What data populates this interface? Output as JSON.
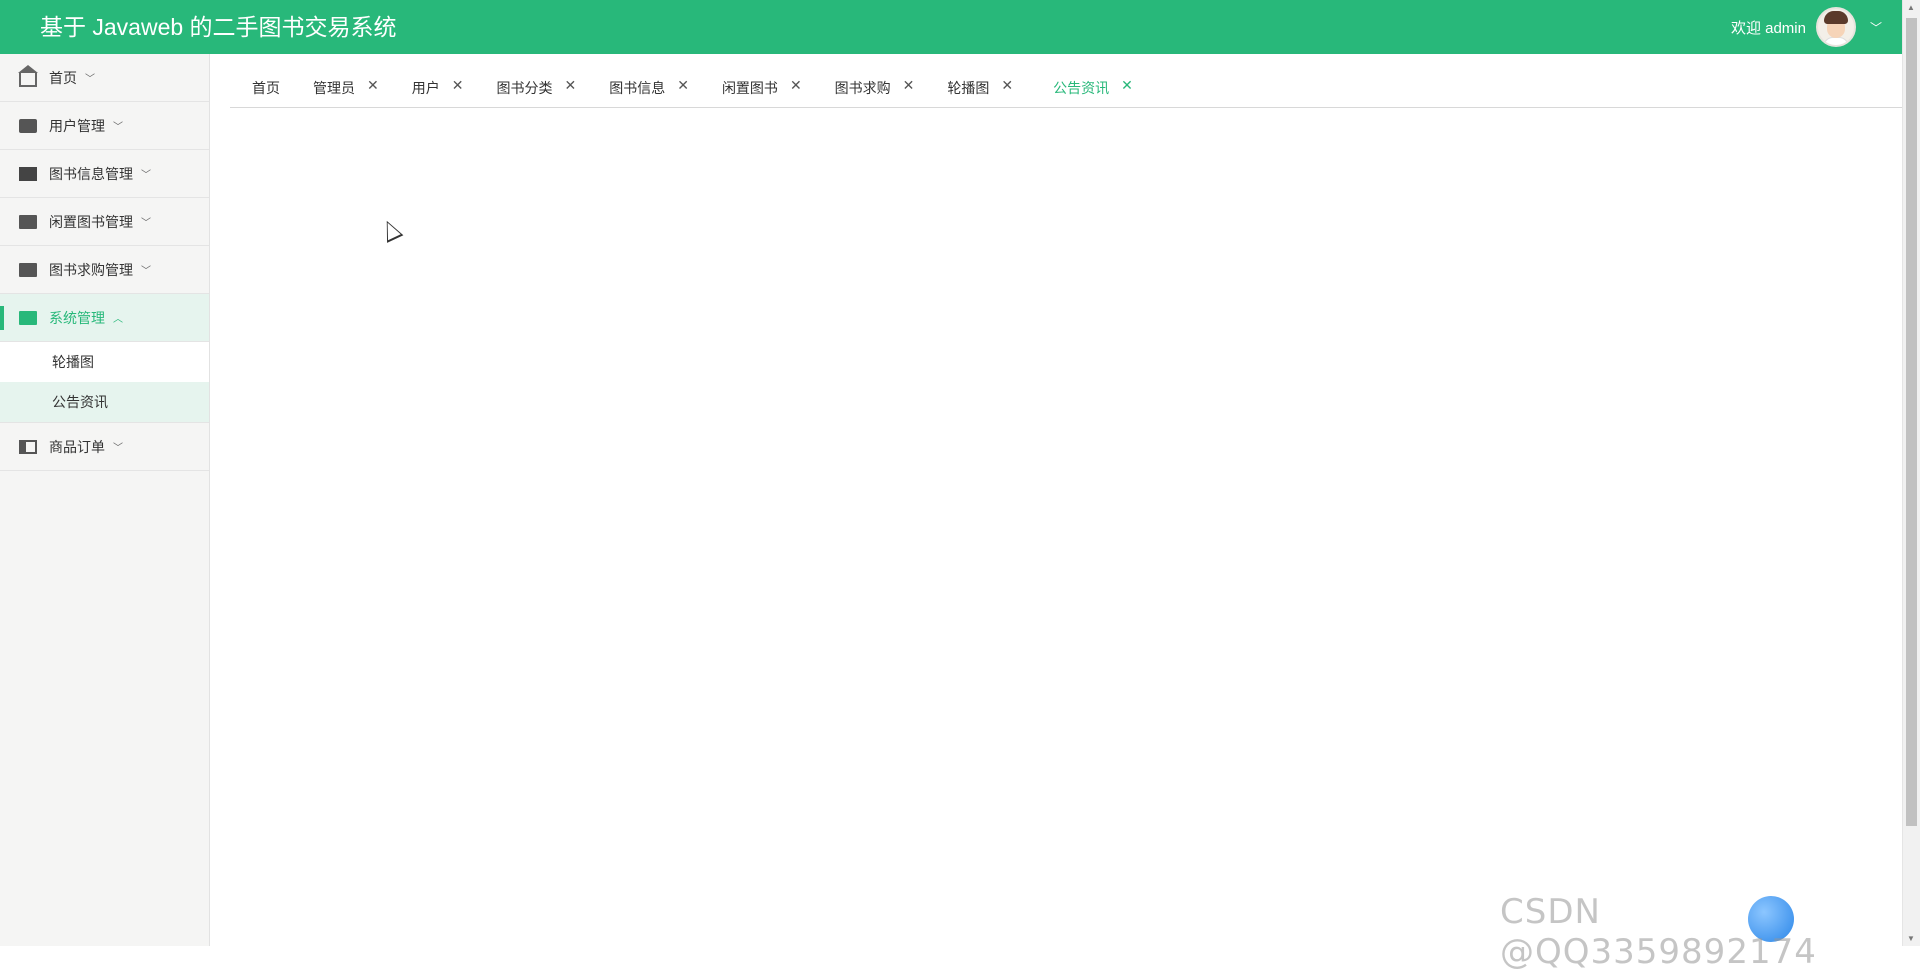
{
  "header": {
    "title": "基于 Javaweb 的二手图书交易系统",
    "welcome": "欢迎 admin",
    "chevron_icon": "chevron-down-icon"
  },
  "sidebar": {
    "items": [
      {
        "label": "首页",
        "icon": "home-icon",
        "arrow": "﹀"
      },
      {
        "label": "用户管理",
        "icon": "wallet-icon",
        "arrow": "﹀"
      },
      {
        "label": "图书信息管理",
        "icon": "bar-icon",
        "arrow": "﹀"
      },
      {
        "label": "闲置图书管理",
        "icon": "gift-icon",
        "arrow": "﹀"
      },
      {
        "label": "图书求购管理",
        "icon": "archive-icon",
        "arrow": "﹀"
      },
      {
        "label": "系统管理",
        "icon": "book-icon",
        "arrow": "︿",
        "active": true,
        "children": [
          {
            "label": "轮播图"
          },
          {
            "label": "公告资讯",
            "active": true
          }
        ]
      },
      {
        "label": "商品订单",
        "icon": "card-icon",
        "arrow": "﹀"
      }
    ]
  },
  "tabs": [
    {
      "label": "首页",
      "closable": false
    },
    {
      "label": "管理员",
      "closable": true
    },
    {
      "label": "用户",
      "closable": true
    },
    {
      "label": "图书分类",
      "closable": true
    },
    {
      "label": "图书信息",
      "closable": true
    },
    {
      "label": "闲置图书",
      "closable": true
    },
    {
      "label": "图书求购",
      "closable": true
    },
    {
      "label": "轮播图",
      "closable": true
    },
    {
      "label": "公告资讯",
      "closable": true,
      "active": true
    }
  ],
  "close_glyph": "✕",
  "watermark": "CSDN @QQ3359892174",
  "colors": {
    "accent": "#28b87a",
    "active_bg": "#e6f4ee",
    "sidebar_bg": "#f5f5f4"
  }
}
